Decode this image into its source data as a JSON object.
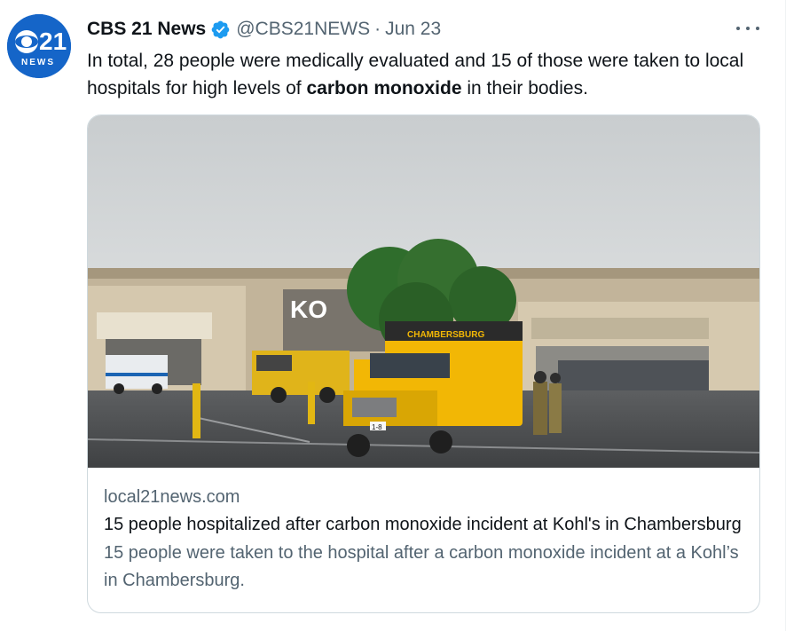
{
  "author": {
    "display_name": "CBS 21 News",
    "handle": "@CBS21NEWS",
    "separator": "·",
    "date": "Jun 23",
    "avatar_text": "NEWS",
    "avatar_number": "21",
    "verified_icon": "verified-badge-icon"
  },
  "tweet": {
    "text_before": "In total, 28 people were medically evaluated and 15 of those were taken to local hospitals for high levels of ",
    "text_bold": "carbon monoxide",
    "text_after": " in their bodies."
  },
  "card": {
    "domain": "local21news.com",
    "title": "15 people hospitalized after carbon monoxide incident at Kohl's in Chambersburg",
    "description": "15 people were taken to the hospital after a carbon monoxide incident at a Kohl’s in Chambersburg.",
    "image": {
      "store_sign": "KO",
      "truck_banner": "CHAMBERSBURG",
      "truck_plate": "1-8"
    }
  },
  "colors": {
    "brand_blue": "#1d9bf0",
    "avatar_blue": "#1565c8",
    "text_primary": "#0f1419",
    "text_secondary": "#536471",
    "card_border": "#cfd9de",
    "truck_yellow": "#f2b705"
  },
  "icons": {
    "more": "more-options-icon"
  }
}
